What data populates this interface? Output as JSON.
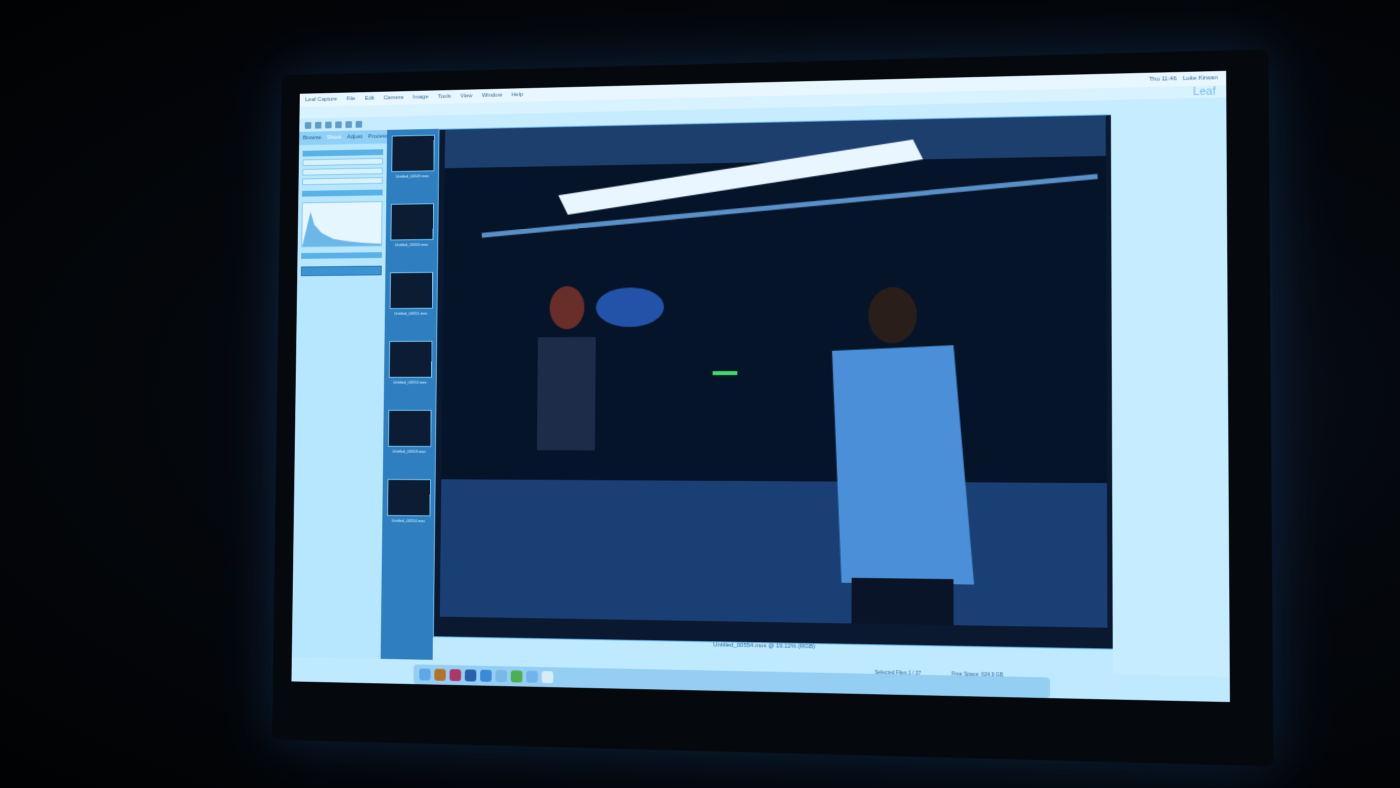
{
  "menubar": {
    "items": [
      "Leaf Capture",
      "File",
      "Edit",
      "Camera",
      "Image",
      "Tools",
      "View",
      "Window",
      "Help"
    ],
    "clock": "Thu 11:46",
    "user": "Luke Kirwan"
  },
  "window": {
    "logo": "Leaf"
  },
  "left_panel": {
    "tabs": [
      "Browse",
      "Shoot",
      "Adjust",
      "Process"
    ]
  },
  "thumbnails": [
    "Untitled_00549.mos",
    "Untitled_00550.mos",
    "Untitled_00551.mos",
    "Untitled_00552.mos",
    "Untitled_00553.mos",
    "Untitled_00554.mos"
  ],
  "main_view": {
    "caption": "Untitled_00554.mos @ 19.12% (RGB)"
  },
  "status": {
    "selected": "Selected Files 1 / 37",
    "free_space": "Free Space: 634.9 GB"
  },
  "dock": {
    "icons": [
      "finder-icon",
      "bridge-icon",
      "indesign-icon",
      "photoshop-icon",
      "safari-icon",
      "mail-icon",
      "spotify-icon",
      "folder-icon",
      "trash-icon"
    ]
  }
}
